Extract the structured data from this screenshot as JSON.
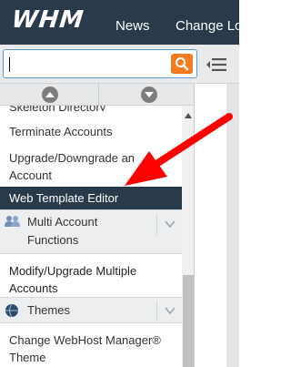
{
  "header": {
    "logo_text": "WHM",
    "nav": [
      "News",
      "Change Lo"
    ]
  },
  "search": {
    "value": "",
    "placeholder": "",
    "button_icon": "search-icon",
    "accent_color": "#f47c20"
  },
  "sidebar": {
    "scroll_up_icon": "chevron-up-icon",
    "scroll_down_icon": "chevron-down-icon",
    "items": {
      "skeleton": "Skeleton Directory",
      "terminate": "Terminate Accounts",
      "upgrade_line1": "Upgrade/Downgrade an",
      "upgrade_line2": "Account",
      "web_template_editor": "Web Template Editor",
      "modify_line1": "Modify/Upgrade Multiple",
      "modify_line2": "Accounts",
      "change_theme_line1": "Change WebHost Manager®",
      "change_theme_line2": "Theme"
    },
    "categories": {
      "multi_line1": "Multi Account",
      "multi_line2": "Functions",
      "themes": "Themes"
    }
  },
  "colors": {
    "header_bg": "#293a4a",
    "active_item_bg": "#293a4a",
    "arrow": "#ff0000"
  }
}
